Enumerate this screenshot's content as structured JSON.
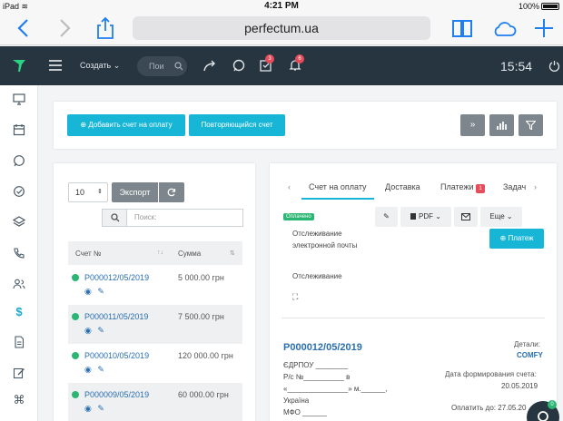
{
  "ios": {
    "device": "iPad",
    "time": "4:21 PM",
    "battery": "100%"
  },
  "browser": {
    "url": "perfectum.ua"
  },
  "header": {
    "create": "Создать ⌄",
    "search_placeholder": "Пои",
    "tasks_badge": "3",
    "notif_badge": "6",
    "clock": "15:54"
  },
  "toolbar": {
    "add_invoice": "⊕ Добавить счет на оплату",
    "recurring": "Повторяющийся счет"
  },
  "list": {
    "page_size": "10",
    "export": "Экспорт",
    "search_placeholder": "Поиск:",
    "columns": [
      "Счет №",
      "Сумма"
    ],
    "rows": [
      {
        "number": "P000012/05/2019",
        "amount": "5 000.00 грн"
      },
      {
        "number": "P000011/05/2019",
        "amount": "7 500.00 грн"
      },
      {
        "number": "P000010/05/2019",
        "amount": "120 000.00 грн"
      },
      {
        "number": "P000009/05/2019",
        "amount": "60 000.00 грн"
      }
    ]
  },
  "detail": {
    "tabs": [
      "Счет на оплату",
      "Доставка",
      "Платежи",
      "Задач"
    ],
    "payments_badge": "1",
    "status_badge": "Оплачено",
    "tracking_email": "Отслеживание электронной почты",
    "tracking": "Отслеживание",
    "pdf": "PDF ⌄",
    "more": "Еще ⌄",
    "payment_btn": "⊕ Платеж",
    "invoice_title": "P000012/05/2019",
    "details_label": "Детали:",
    "company": "COMFY",
    "edrpou": "ЄДРПОУ ________",
    "account": "Р/с №__________ в",
    "bank": "«_______________» м.______,",
    "country": "Україна",
    "mfo": "МФО ______",
    "created_label": "Дата формирования счета:",
    "created_date": "20.05.2019",
    "pay_until": "Оплатить до: 27.05.20",
    "chat_badge": "0"
  }
}
